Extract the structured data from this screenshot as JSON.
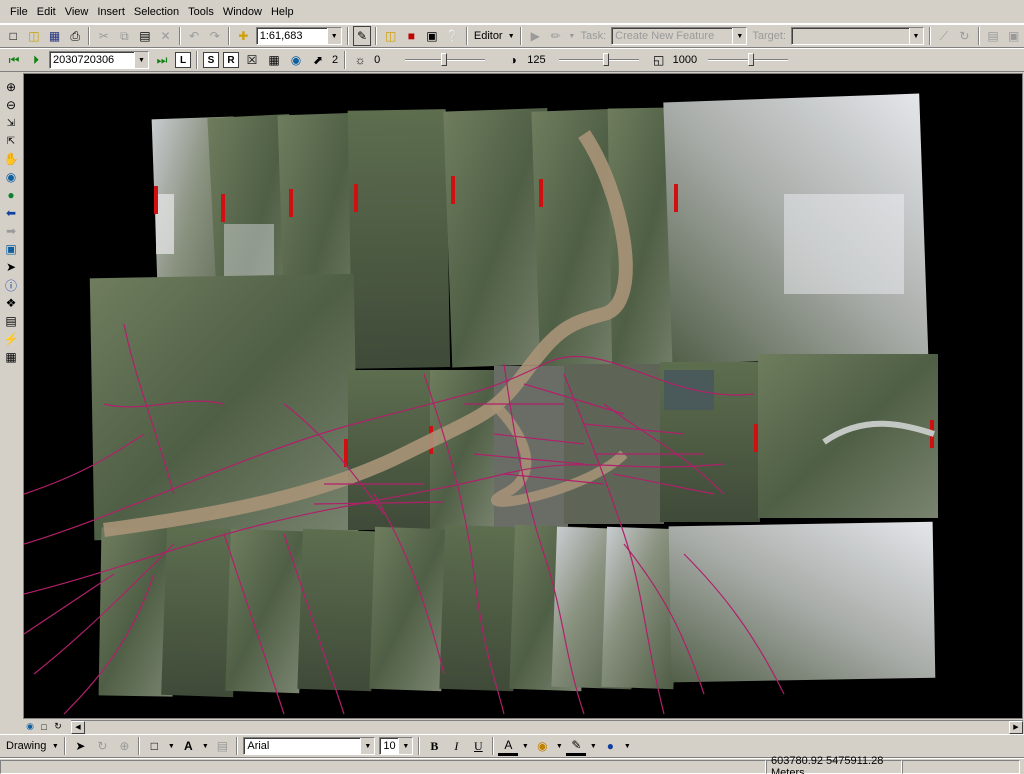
{
  "menu": [
    "File",
    "Edit",
    "View",
    "Insert",
    "Selection",
    "Tools",
    "Window",
    "Help"
  ],
  "standard_toolbar": {
    "scale": "1:61,683",
    "editor_label": "Editor",
    "task_label": "Task:",
    "task_value": "Create New Feature",
    "target_label": "Target:",
    "target_value": ""
  },
  "image_toolbar": {
    "date_value": "2030720306",
    "btn_l": "L",
    "btn_s": "S",
    "btn_r": "R",
    "btn_n": "2",
    "brightness": "0",
    "contrast": "125",
    "transparency": "1000"
  },
  "drawing_toolbar": {
    "drawing_label": "Drawing",
    "font_name": "Arial",
    "font_size": "10",
    "bold": "B",
    "italic": "I",
    "underline": "U",
    "text_tool": "A"
  },
  "status": {
    "coordinates": "603780.92  5475911.28 Meters"
  },
  "colors": {
    "map_background": "#000000",
    "roads": "#b0206a",
    "river": "#a89478"
  },
  "icons": [
    "new-icon",
    "open-icon",
    "save-icon",
    "print-icon",
    "cut-icon",
    "copy-icon",
    "paste-icon",
    "delete-icon",
    "undo-icon",
    "redo-icon",
    "add-data-icon",
    "editor-toolbar-icon",
    "arctoolbox-icon",
    "command-line-icon",
    "whats-this-icon",
    "zoom-in-icon",
    "zoom-out-icon",
    "pan-icon",
    "full-extent-icon",
    "identify-icon",
    "find-icon",
    "measure-icon",
    "select-icon"
  ]
}
